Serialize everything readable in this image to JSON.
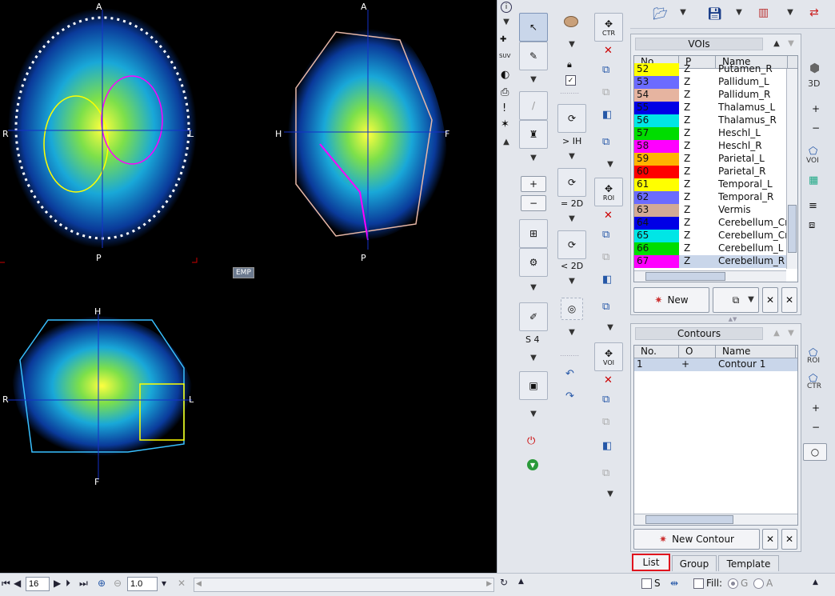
{
  "viewer": {
    "axial": {
      "top": "A",
      "bottom": "P",
      "left": "R",
      "right": "L"
    },
    "sagittal": {
      "top": "A",
      "bottom": "P",
      "left": "H",
      "right": "F"
    },
    "coronal": {
      "top": "H",
      "bottom": "F",
      "left": "R",
      "right": "L"
    },
    "emp_label": "EMP"
  },
  "bottombar": {
    "slice": "16",
    "zoom": "1.0",
    "s_label": "S",
    "fill_label": "Fill:",
    "g_label": "G",
    "a_label": "A"
  },
  "toolcol": {
    "ih_label": "> IH",
    "eq2d_label": "= 2D",
    "lt2d_label": "< 2D",
    "s4_label": "S 4",
    "ctr_label": "CTR",
    "roi_label": "ROI",
    "voi_label": "VOI"
  },
  "vois": {
    "title": "VOIs",
    "columns": [
      "No.",
      "P",
      "Name"
    ],
    "rows": [
      {
        "no": "52",
        "p": "Z",
        "name": "Putamen_R",
        "color": "#ffff00"
      },
      {
        "no": "53",
        "p": "Z",
        "name": "Pallidum_L",
        "color": "#6b6bff"
      },
      {
        "no": "54",
        "p": "Z",
        "name": "Pallidum_R",
        "color": "#e6b4a0"
      },
      {
        "no": "55",
        "p": "Z",
        "name": "Thalamus_L",
        "color": "#0000e6"
      },
      {
        "no": "56",
        "p": "Z",
        "name": "Thalamus_R",
        "color": "#00e6e6"
      },
      {
        "no": "57",
        "p": "Z",
        "name": "Heschl_L",
        "color": "#00dd00"
      },
      {
        "no": "58",
        "p": "Z",
        "name": "Heschl_R",
        "color": "#ff00ff"
      },
      {
        "no": "59",
        "p": "Z",
        "name": "Parietal_L",
        "color": "#ffb400"
      },
      {
        "no": "60",
        "p": "Z",
        "name": "Parietal_R",
        "color": "#ff0000"
      },
      {
        "no": "61",
        "p": "Z",
        "name": "Temporal_L",
        "color": "#ffff00"
      },
      {
        "no": "62",
        "p": "Z",
        "name": "Temporal_R",
        "color": "#6b6bff"
      },
      {
        "no": "63",
        "p": "Z",
        "name": "Vermis",
        "color": "#d2aa96"
      },
      {
        "no": "64",
        "p": "Z",
        "name": "Cerebellum_Cr",
        "color": "#0000e6"
      },
      {
        "no": "65",
        "p": "Z",
        "name": "Cerebellum_Cr",
        "color": "#00e6e6"
      },
      {
        "no": "66",
        "p": "Z",
        "name": "Cerebellum_L",
        "color": "#00dd00"
      },
      {
        "no": "67",
        "p": "Z",
        "name": "Cerebellum_R",
        "color": "#ff00ff"
      }
    ],
    "new_label": "New",
    "side_3d": "3D",
    "side_voi": "VOI"
  },
  "contours": {
    "title": "Contours",
    "columns": [
      "No.",
      "O",
      "Name"
    ],
    "rows": [
      {
        "no": "1",
        "o": "+",
        "name": "Contour 1"
      }
    ],
    "new_label": "New Contour",
    "side_roi": "ROI",
    "side_ctr": "CTR"
  },
  "tabs": [
    "List",
    "Group",
    "Template"
  ]
}
